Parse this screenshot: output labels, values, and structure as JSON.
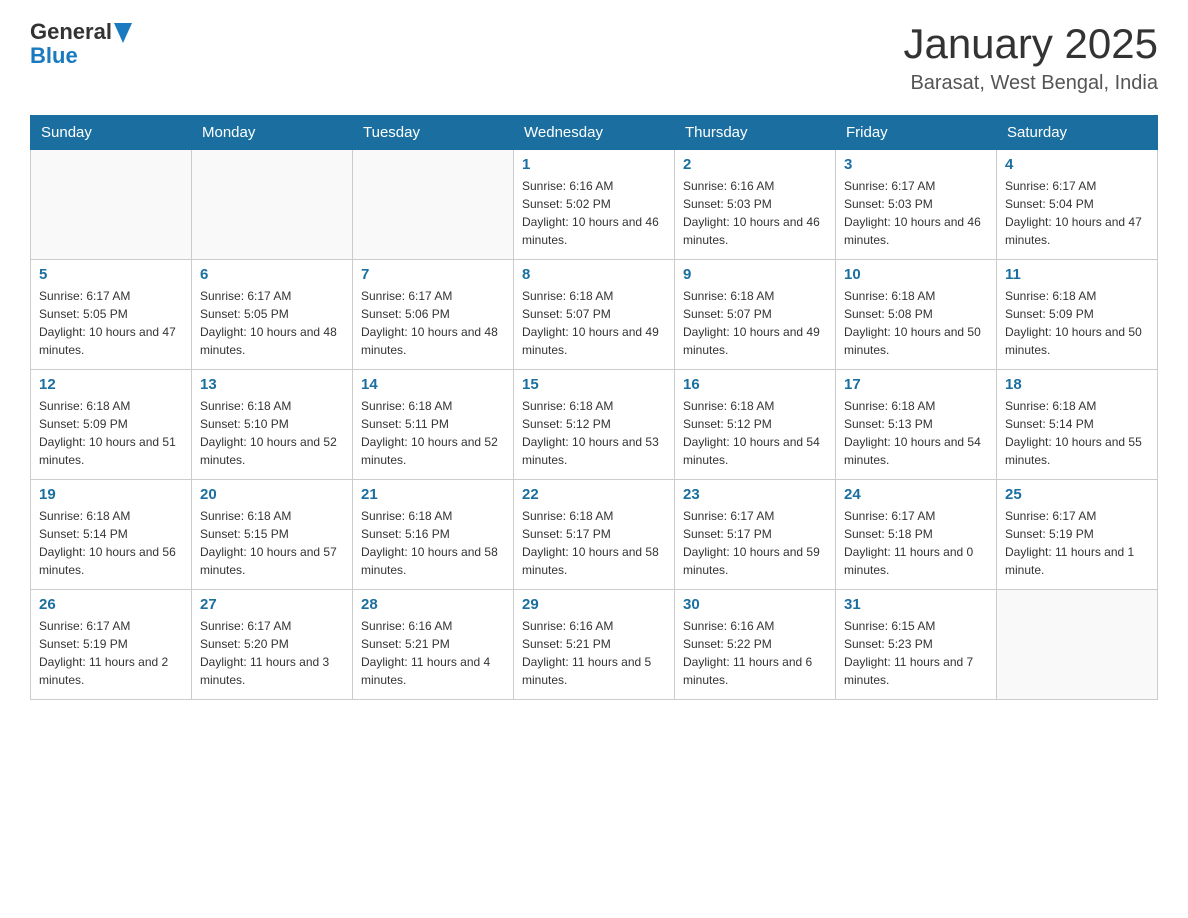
{
  "logo": {
    "general": "General",
    "blue": "Blue"
  },
  "header": {
    "title": "January 2025",
    "subtitle": "Barasat, West Bengal, India"
  },
  "days_of_week": [
    "Sunday",
    "Monday",
    "Tuesday",
    "Wednesday",
    "Thursday",
    "Friday",
    "Saturday"
  ],
  "weeks": [
    [
      {
        "day": "",
        "info": ""
      },
      {
        "day": "",
        "info": ""
      },
      {
        "day": "",
        "info": ""
      },
      {
        "day": "1",
        "info": "Sunrise: 6:16 AM\nSunset: 5:02 PM\nDaylight: 10 hours and 46 minutes."
      },
      {
        "day": "2",
        "info": "Sunrise: 6:16 AM\nSunset: 5:03 PM\nDaylight: 10 hours and 46 minutes."
      },
      {
        "day": "3",
        "info": "Sunrise: 6:17 AM\nSunset: 5:03 PM\nDaylight: 10 hours and 46 minutes."
      },
      {
        "day": "4",
        "info": "Sunrise: 6:17 AM\nSunset: 5:04 PM\nDaylight: 10 hours and 47 minutes."
      }
    ],
    [
      {
        "day": "5",
        "info": "Sunrise: 6:17 AM\nSunset: 5:05 PM\nDaylight: 10 hours and 47 minutes."
      },
      {
        "day": "6",
        "info": "Sunrise: 6:17 AM\nSunset: 5:05 PM\nDaylight: 10 hours and 48 minutes."
      },
      {
        "day": "7",
        "info": "Sunrise: 6:17 AM\nSunset: 5:06 PM\nDaylight: 10 hours and 48 minutes."
      },
      {
        "day": "8",
        "info": "Sunrise: 6:18 AM\nSunset: 5:07 PM\nDaylight: 10 hours and 49 minutes."
      },
      {
        "day": "9",
        "info": "Sunrise: 6:18 AM\nSunset: 5:07 PM\nDaylight: 10 hours and 49 minutes."
      },
      {
        "day": "10",
        "info": "Sunrise: 6:18 AM\nSunset: 5:08 PM\nDaylight: 10 hours and 50 minutes."
      },
      {
        "day": "11",
        "info": "Sunrise: 6:18 AM\nSunset: 5:09 PM\nDaylight: 10 hours and 50 minutes."
      }
    ],
    [
      {
        "day": "12",
        "info": "Sunrise: 6:18 AM\nSunset: 5:09 PM\nDaylight: 10 hours and 51 minutes."
      },
      {
        "day": "13",
        "info": "Sunrise: 6:18 AM\nSunset: 5:10 PM\nDaylight: 10 hours and 52 minutes."
      },
      {
        "day": "14",
        "info": "Sunrise: 6:18 AM\nSunset: 5:11 PM\nDaylight: 10 hours and 52 minutes."
      },
      {
        "day": "15",
        "info": "Sunrise: 6:18 AM\nSunset: 5:12 PM\nDaylight: 10 hours and 53 minutes."
      },
      {
        "day": "16",
        "info": "Sunrise: 6:18 AM\nSunset: 5:12 PM\nDaylight: 10 hours and 54 minutes."
      },
      {
        "day": "17",
        "info": "Sunrise: 6:18 AM\nSunset: 5:13 PM\nDaylight: 10 hours and 54 minutes."
      },
      {
        "day": "18",
        "info": "Sunrise: 6:18 AM\nSunset: 5:14 PM\nDaylight: 10 hours and 55 minutes."
      }
    ],
    [
      {
        "day": "19",
        "info": "Sunrise: 6:18 AM\nSunset: 5:14 PM\nDaylight: 10 hours and 56 minutes."
      },
      {
        "day": "20",
        "info": "Sunrise: 6:18 AM\nSunset: 5:15 PM\nDaylight: 10 hours and 57 minutes."
      },
      {
        "day": "21",
        "info": "Sunrise: 6:18 AM\nSunset: 5:16 PM\nDaylight: 10 hours and 58 minutes."
      },
      {
        "day": "22",
        "info": "Sunrise: 6:18 AM\nSunset: 5:17 PM\nDaylight: 10 hours and 58 minutes."
      },
      {
        "day": "23",
        "info": "Sunrise: 6:17 AM\nSunset: 5:17 PM\nDaylight: 10 hours and 59 minutes."
      },
      {
        "day": "24",
        "info": "Sunrise: 6:17 AM\nSunset: 5:18 PM\nDaylight: 11 hours and 0 minutes."
      },
      {
        "day": "25",
        "info": "Sunrise: 6:17 AM\nSunset: 5:19 PM\nDaylight: 11 hours and 1 minute."
      }
    ],
    [
      {
        "day": "26",
        "info": "Sunrise: 6:17 AM\nSunset: 5:19 PM\nDaylight: 11 hours and 2 minutes."
      },
      {
        "day": "27",
        "info": "Sunrise: 6:17 AM\nSunset: 5:20 PM\nDaylight: 11 hours and 3 minutes."
      },
      {
        "day": "28",
        "info": "Sunrise: 6:16 AM\nSunset: 5:21 PM\nDaylight: 11 hours and 4 minutes."
      },
      {
        "day": "29",
        "info": "Sunrise: 6:16 AM\nSunset: 5:21 PM\nDaylight: 11 hours and 5 minutes."
      },
      {
        "day": "30",
        "info": "Sunrise: 6:16 AM\nSunset: 5:22 PM\nDaylight: 11 hours and 6 minutes."
      },
      {
        "day": "31",
        "info": "Sunrise: 6:15 AM\nSunset: 5:23 PM\nDaylight: 11 hours and 7 minutes."
      },
      {
        "day": "",
        "info": ""
      }
    ]
  ]
}
